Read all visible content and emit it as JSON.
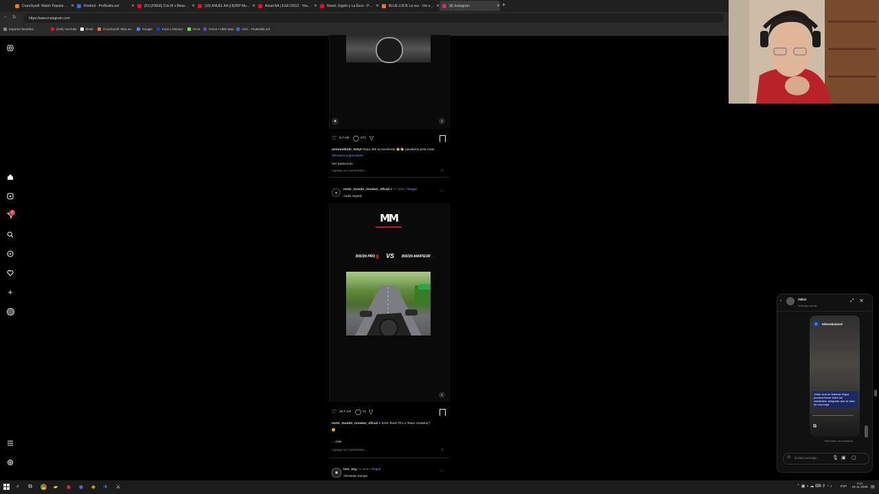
{
  "browser": {
    "tabs": [
      {
        "label": "Crunchyroll: Watch Popular Anim...",
        "color": "#f47521"
      },
      {
        "label": "Kindred - ProBuilds.net",
        "color": "#2a6fd6"
      },
      {
        "label": "(51) [FREE] Cris M x Blessd x To...",
        "color": "#ff0033"
      },
      {
        "label": "(10) ANUEL AA || BZRP Music Se...",
        "color": "#ff0033"
      },
      {
        "label": "Anuel AA | ESA CRUZ - YouTube",
        "color": "#ff0033"
      },
      {
        "label": "Nonel, Gigolo y La Exce - Pensán...",
        "color": "#ff0033"
      },
      {
        "label": "BLUE LOCK La voz - Ver en Crun...",
        "color": "#f47521"
      },
      {
        "label": "(8) Instagram",
        "color": "#d62976"
      }
    ],
    "url": "https://www.instagram.com",
    "bookmarks": [
      {
        "label": "Importar favoritos",
        "color": "#888"
      },
      {
        "label": "(228) YouTube",
        "color": "#ff0033"
      },
      {
        "label": "tiktok",
        "color": "#eee"
      },
      {
        "label": "Crunchyroll: Mira an...",
        "color": "#f47521"
      },
      {
        "label": "Google",
        "color": "#4285f4"
      },
      {
        "label": "Inicio | Disney+",
        "color": "#113ccf"
      },
      {
        "label": "KICK",
        "color": "#53fc18"
      },
      {
        "label": "Home • HBO Max",
        "color": "#6b3fd4"
      },
      {
        "label": "ADC - ProBuilds.net",
        "color": "#2a6fd6"
      }
    ]
  },
  "sidebar": {
    "badge_count": "8",
    "icons": [
      "instagram-logo-icon",
      "home-icon",
      "reels-icon",
      "messages-icon",
      "search-icon",
      "explore-icon",
      "notifications-icon",
      "create-icon",
      "profile-icon",
      "menu-icon",
      "threads-icon"
    ]
  },
  "post1": {
    "likes": "5,7 mil",
    "comments": "271",
    "caption_user": "antoniolilutti_043yt",
    "caption_text": "Ninja 400 ta excelente 👏🏼👏🏼 parabéns pela moto",
    "mention": "@moacir.a.goncalves",
    "see_translation": "Ver traducción",
    "add_comment": "Agrega un comentario..."
  },
  "post2": {
    "username": "moto_mundo_reviews_oficial",
    "time": "• 7 sem •",
    "follow": "Seguir",
    "audio": "Audio original",
    "logo_text": "MM",
    "versus_left": "BISON PRO",
    "versus_mid": "VS",
    "versus_right": "BISON AMATEUR",
    "likes": "16,7 mil",
    "comments": "71",
    "caption_user": "moto_mundo_reviews_oficial",
    "caption_text": "Eres Team Pro o Team Amateur?",
    "more": "... más",
    "add_comment": "Agrega un comentario..."
  },
  "post3": {
    "username": "txm_org",
    "time": "• 1 sem •",
    "follow": "Seguir",
    "location": "Alemania, Europa"
  },
  "chat": {
    "name": "rakzz",
    "status": "Activo(a) ahora",
    "shared_account": "telenoticiasrd",
    "shared_caption": "Video viral en Sabana Yegua provoca temor entre los residentes: aseguran que se trata de una bruja",
    "sent_time": "Visto hace un momento",
    "input_placeholder": "Enviar mensaje..."
  },
  "taskbar": {
    "lang": "ESP",
    "time": "4:11",
    "date": "15-11-2025"
  }
}
